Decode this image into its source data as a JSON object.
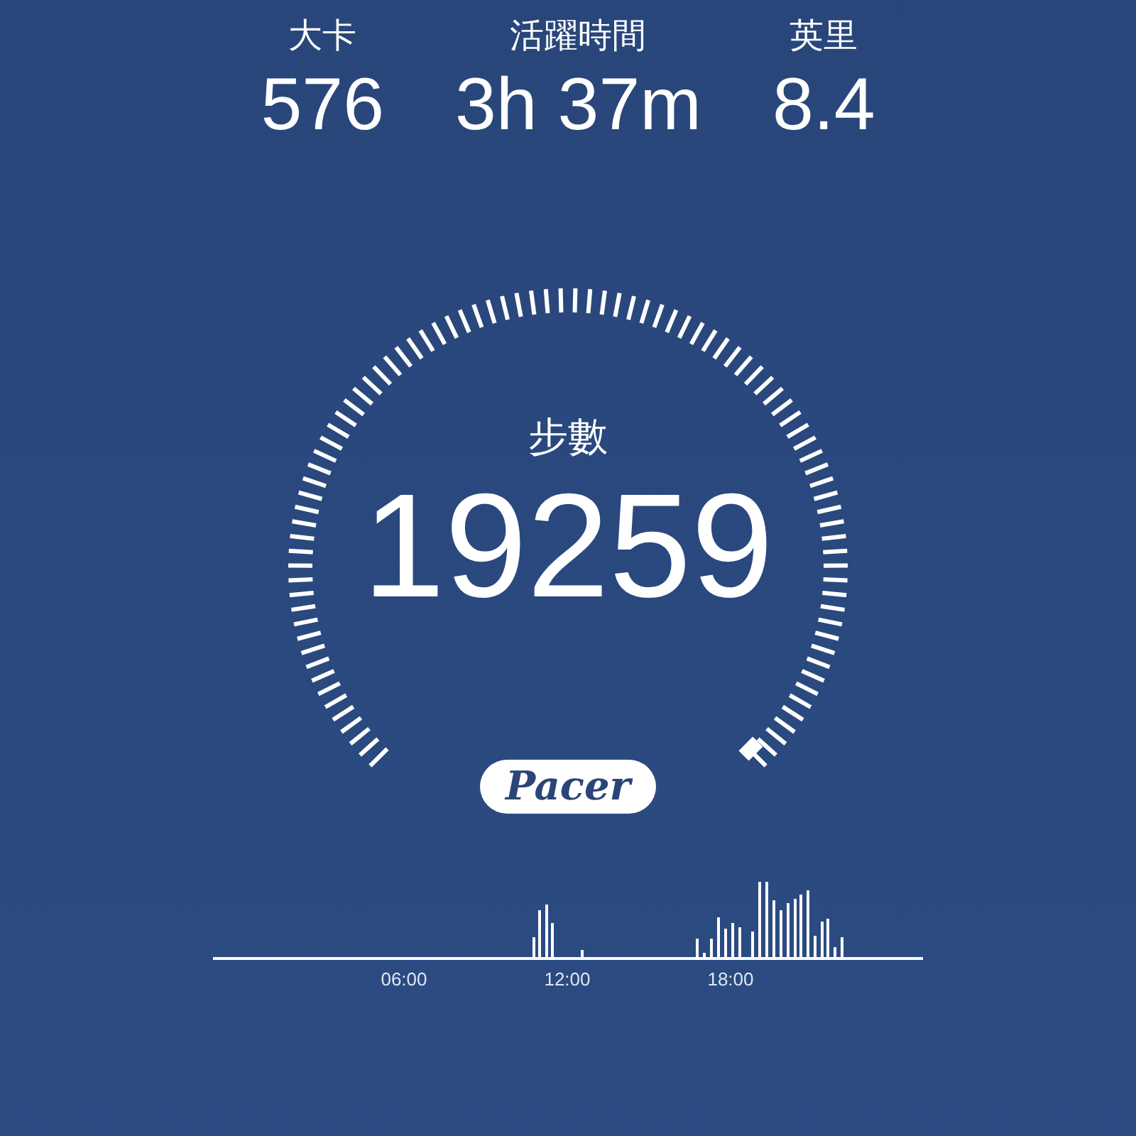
{
  "stats": [
    {
      "label": "大卡",
      "value": "576"
    },
    {
      "label": "活躍時間",
      "value": "3h 37m"
    },
    {
      "label": "英里",
      "value": "8.4"
    }
  ],
  "steps": {
    "label": "步數",
    "value": "19259"
  },
  "logo": "Pacer",
  "activity_chart": {
    "x_labels": [
      "06:00",
      "12:00",
      "18:00"
    ]
  }
}
